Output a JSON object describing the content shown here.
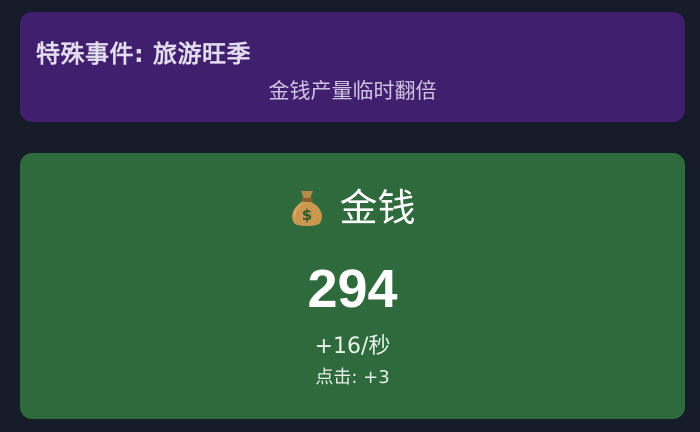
{
  "event": {
    "title": "特殊事件: 旅游旺季",
    "description": "金钱产量临时翻倍",
    "background_color": "#3f1f6e"
  },
  "resource": {
    "icon": "moneybag-icon",
    "name": "金钱",
    "amount": "294",
    "rate": "+16/秒",
    "click": "点击: +3",
    "background_color": "#2f6a3c"
  },
  "page_background": "#151b28"
}
